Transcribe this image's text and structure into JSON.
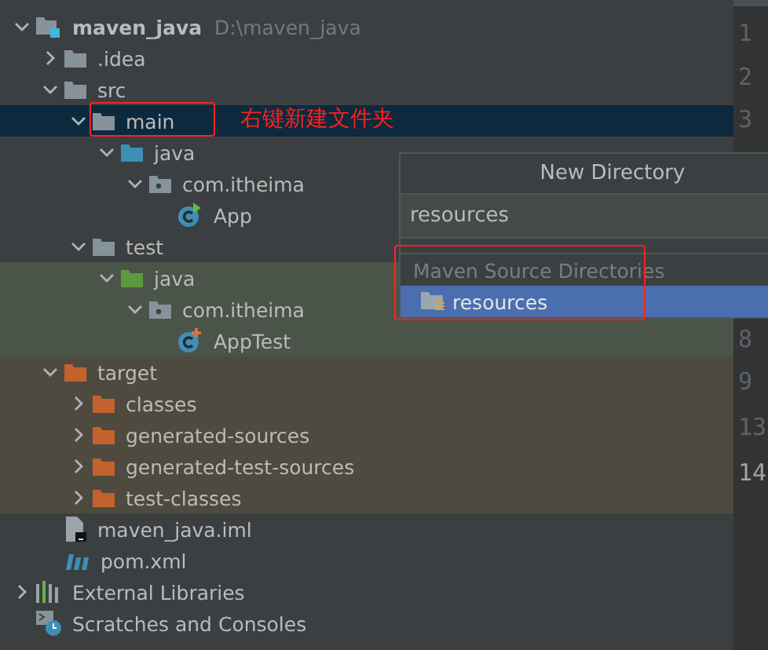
{
  "project_tree": [
    {
      "label": "maven_java",
      "path": "D:\\maven_java",
      "kind": "module",
      "expanded": true,
      "selected": false,
      "children": [
        {
          "label": ".idea",
          "kind": "folder",
          "expanded": false,
          "selected": false
        },
        {
          "label": "src",
          "kind": "folder",
          "expanded": true,
          "selected": false,
          "children": [
            {
              "label": "main",
              "kind": "folder",
              "expanded": true,
              "selected": true,
              "children": [
                {
                  "label": "java",
                  "kind": "source",
                  "expanded": true,
                  "selected": false,
                  "children": [
                    {
                      "label": "com.itheima",
                      "kind": "package",
                      "expanded": true,
                      "selected": false,
                      "children": [
                        {
                          "label": "App",
                          "kind": "class",
                          "selected": false
                        }
                      ]
                    }
                  ]
                }
              ]
            },
            {
              "label": "test",
              "kind": "folder",
              "expanded": true,
              "selected": false,
              "children": [
                {
                  "label": "java",
                  "kind": "test-source",
                  "expanded": true,
                  "selected": false,
                  "children": [
                    {
                      "label": "com.itheima",
                      "kind": "package",
                      "expanded": true,
                      "selected": false,
                      "children": [
                        {
                          "label": "AppTest",
                          "kind": "test-class",
                          "selected": false
                        }
                      ]
                    }
                  ]
                }
              ]
            }
          ]
        },
        {
          "label": "target",
          "kind": "excluded",
          "expanded": true,
          "selected": false,
          "children": [
            {
              "label": "classes",
              "kind": "excluded",
              "expanded": false,
              "selected": false
            },
            {
              "label": "generated-sources",
              "kind": "excluded",
              "expanded": false,
              "selected": false
            },
            {
              "label": "generated-test-sources",
              "kind": "excluded",
              "expanded": false,
              "selected": false
            },
            {
              "label": "test-classes",
              "kind": "excluded",
              "expanded": false,
              "selected": false
            }
          ]
        },
        {
          "label": "maven_java.iml",
          "kind": "iml",
          "selected": false
        },
        {
          "label": "pom.xml",
          "kind": "pom",
          "selected": false
        }
      ]
    },
    {
      "label": "External Libraries",
      "kind": "libraries",
      "expanded": false,
      "selected": false
    },
    {
      "label": "Scratches and Consoles",
      "kind": "scratches",
      "selected": false
    }
  ],
  "annotation": {
    "note": "右键新建文件夹",
    "color": "#ff2020"
  },
  "new_directory_popup": {
    "title": "New Directory",
    "value": "resources",
    "group": "Maven Source Directories",
    "items": [
      {
        "label": "resources",
        "selected": true
      }
    ]
  },
  "gutter": [
    {
      "text": "1",
      "current": false
    },
    {
      "text": "2",
      "current": false
    },
    {
      "text": "3",
      "current": false
    },
    {
      "text": "8",
      "current": false
    },
    {
      "text": "9",
      "current": false
    },
    {
      "text": "13",
      "current": false
    },
    {
      "text": "14",
      "current": true
    }
  ]
}
